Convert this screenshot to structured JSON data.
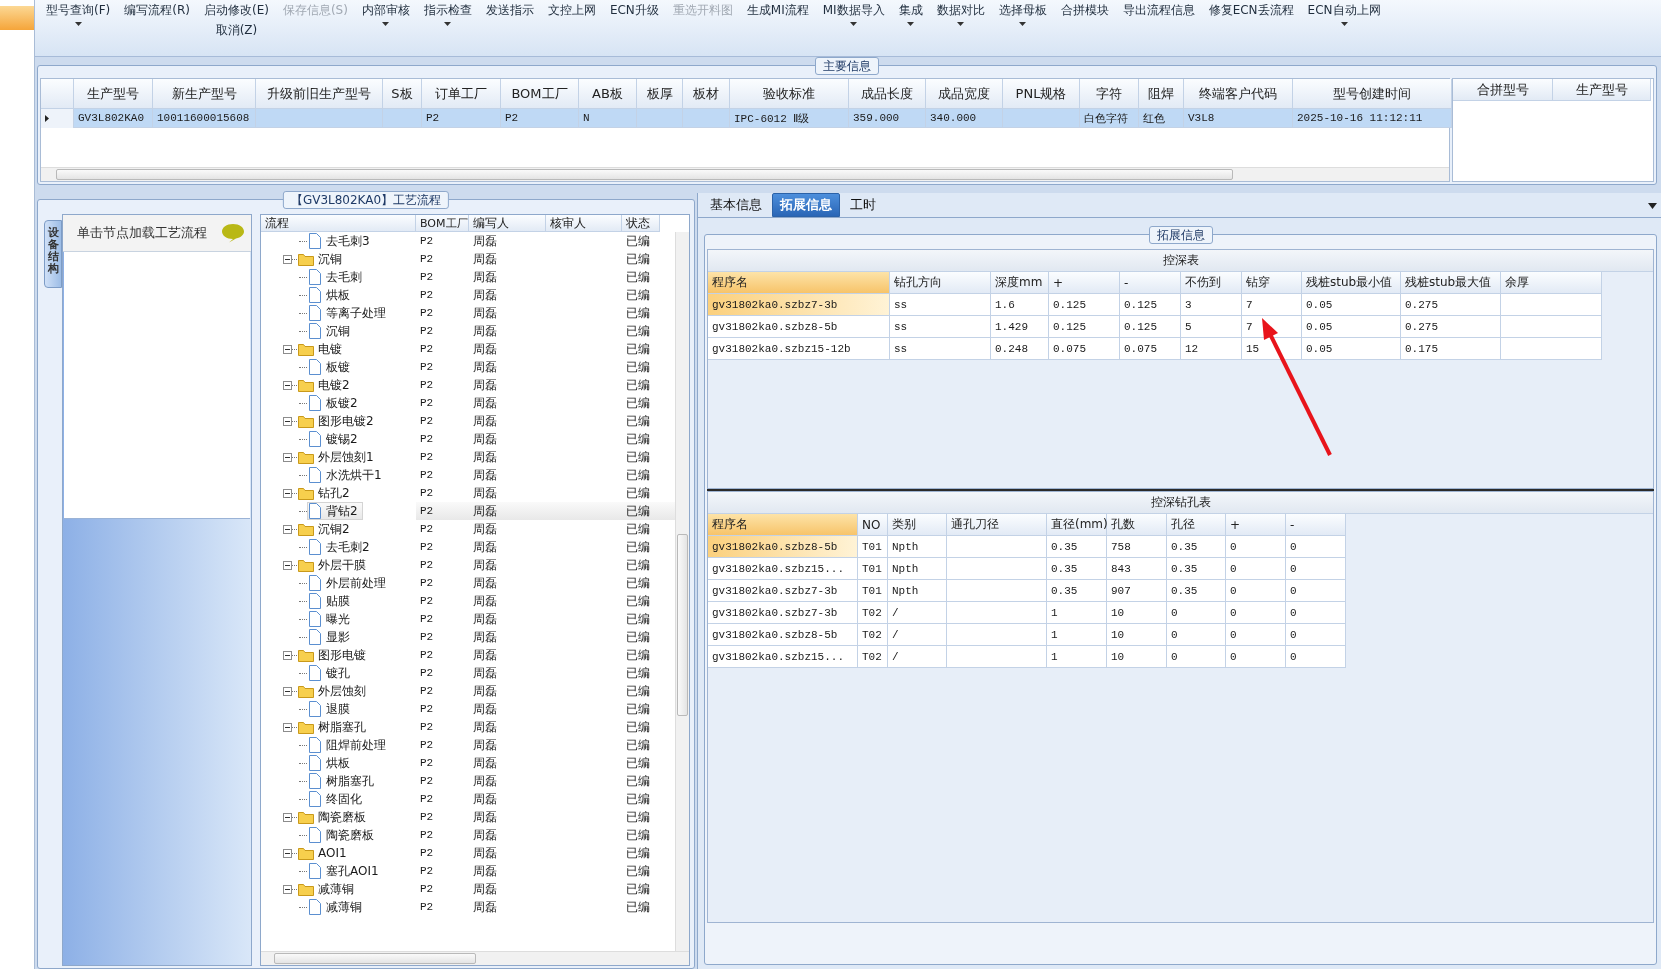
{
  "toolbar": [
    {
      "label": "型号查询(F)",
      "dropdown": true,
      "disabled": false
    },
    {
      "label": "编写流程(R)",
      "dropdown": false,
      "disabled": false
    },
    {
      "label": "启动修改(E)",
      "sublabel": "取消(Z)",
      "dropdown": false,
      "disabled": false
    },
    {
      "label": "保存信息(S)",
      "dropdown": false,
      "disabled": true
    },
    {
      "label": "内部审核",
      "dropdown": true,
      "disabled": false
    },
    {
      "label": "指示检查",
      "dropdown": true,
      "disabled": false
    },
    {
      "label": "发送指示",
      "dropdown": false,
      "disabled": false
    },
    {
      "label": "文控上网",
      "dropdown": false,
      "disabled": false
    },
    {
      "label": "ECN升级",
      "dropdown": false,
      "disabled": false
    },
    {
      "label": "重选开料图",
      "dropdown": false,
      "disabled": true
    },
    {
      "label": "生成MI流程",
      "dropdown": false,
      "disabled": false
    },
    {
      "label": "MI数据导入",
      "dropdown": true,
      "disabled": false
    },
    {
      "label": "集成",
      "dropdown": true,
      "disabled": false
    },
    {
      "label": "数据对比",
      "dropdown": true,
      "disabled": false
    },
    {
      "label": "选择母板",
      "dropdown": true,
      "disabled": false
    },
    {
      "label": "合拼模块",
      "dropdown": false,
      "disabled": false
    },
    {
      "label": "导出流程信息",
      "dropdown": false,
      "disabled": false
    },
    {
      "label": "修复ECN丢流程",
      "dropdown": false,
      "disabled": false
    },
    {
      "label": "ECN自动上网",
      "dropdown": true,
      "disabled": false
    }
  ],
  "main_info": {
    "title": "主要信息",
    "columns": [
      "生产型号",
      "新生产型号",
      "升级前旧生产型号",
      "S板",
      "订单工厂",
      "BOM工厂",
      "AB板",
      "板厚",
      "板材",
      "验收标准",
      "成品长度",
      "成品宽度",
      "PNL规格",
      "字符",
      "阻焊",
      "终端客户代码",
      "型号创建时间"
    ],
    "rows": [
      {
        "selected": true,
        "cells": [
          "GV3L802KA0",
          "10011600015608",
          null,
          null,
          "P2",
          "P2",
          "N",
          null,
          null,
          "IPC-6012 Ⅱ级",
          "359.000",
          "340.000",
          null,
          "白色字符",
          "红色",
          "V3L8",
          "2025-10-16 11:12:11"
        ]
      }
    ],
    "merge_table": {
      "columns": [
        "合拼型号",
        "生产型号"
      ]
    }
  },
  "process_panel": {
    "title": "【GV3L802KA0】工艺流程",
    "side_tab": "设备结构",
    "hint": "单击节点加载工艺流程",
    "columns": [
      "流程",
      "BOM工厂",
      "编写人",
      "核审人",
      "状态"
    ],
    "continued_rows": [
      {
        "label": "去毛刺3",
        "bom": "P2",
        "writer": "周磊",
        "status": "已编",
        "selected": false
      }
    ],
    "rows": [
      {
        "label": "沉铜",
        "bom": "P2",
        "writer": "周磊",
        "status": "已编",
        "selected": false,
        "expanded": true,
        "children": [
          {
            "label": "去毛刺",
            "bom": "P2",
            "writer": "周磊",
            "status": "已编",
            "selected": false
          },
          {
            "label": "烘板",
            "bom": "P2",
            "writer": "周磊",
            "status": "已编",
            "selected": false
          },
          {
            "label": "等离子处理",
            "bom": "P2",
            "writer": "周磊",
            "status": "已编",
            "selected": false
          },
          {
            "label": "沉铜",
            "bom": "P2",
            "writer": "周磊",
            "status": "已编",
            "selected": false
          }
        ]
      },
      {
        "label": "电镀",
        "bom": "P2",
        "writer": "周磊",
        "status": "已编",
        "selected": false,
        "expanded": true,
        "children": [
          {
            "label": "板镀",
            "bom": "P2",
            "writer": "周磊",
            "status": "已编",
            "selected": false
          }
        ]
      },
      {
        "label": "电镀2",
        "bom": "P2",
        "writer": "周磊",
        "status": "已编",
        "selected": false,
        "expanded": true,
        "children": [
          {
            "label": "板镀2",
            "bom": "P2",
            "writer": "周磊",
            "status": "已编",
            "selected": false
          }
        ]
      },
      {
        "label": "图形电镀2",
        "bom": "P2",
        "writer": "周磊",
        "status": "已编",
        "selected": false,
        "expanded": true,
        "children": [
          {
            "label": "镀锡2",
            "bom": "P2",
            "writer": "周磊",
            "status": "已编",
            "selected": false
          }
        ]
      },
      {
        "label": "外层蚀刻1",
        "bom": "P2",
        "writer": "周磊",
        "status": "已编",
        "selected": false,
        "expanded": true,
        "children": [
          {
            "label": "水洗烘干1",
            "bom": "P2",
            "writer": "周磊",
            "status": "已编",
            "selected": false
          }
        ]
      },
      {
        "label": "钻孔2",
        "bom": "P2",
        "writer": "周磊",
        "status": "已编",
        "selected": false,
        "expanded": true,
        "children": [
          {
            "label": "背钻2",
            "bom": "P2",
            "writer": "周磊",
            "status": "已编",
            "selected": true
          }
        ]
      },
      {
        "label": "沉铜2",
        "bom": "P2",
        "writer": "周磊",
        "status": "已编",
        "selected": false,
        "expanded": true,
        "children": [
          {
            "label": "去毛刺2",
            "bom": "P2",
            "writer": "周磊",
            "status": "已编",
            "selected": false
          }
        ]
      },
      {
        "label": "外层干膜",
        "bom": "P2",
        "writer": "周磊",
        "status": "已编",
        "selected": false,
        "expanded": true,
        "children": [
          {
            "label": "外层前处理",
            "bom": "P2",
            "writer": "周磊",
            "status": "已编",
            "selected": false
          },
          {
            "label": "贴膜",
            "bom": "P2",
            "writer": "周磊",
            "status": "已编",
            "selected": false
          },
          {
            "label": "曝光",
            "bom": "P2",
            "writer": "周磊",
            "status": "已编",
            "selected": false
          },
          {
            "label": "显影",
            "bom": "P2",
            "writer": "周磊",
            "status": "已编",
            "selected": false
          }
        ]
      },
      {
        "label": "图形电镀",
        "bom": "P2",
        "writer": "周磊",
        "status": "已编",
        "selected": false,
        "expanded": true,
        "children": [
          {
            "label": "镀孔",
            "bom": "P2",
            "writer": "周磊",
            "status": "已编",
            "selected": false
          }
        ]
      },
      {
        "label": "外层蚀刻",
        "bom": "P2",
        "writer": "周磊",
        "status": "已编",
        "selected": false,
        "expanded": true,
        "children": [
          {
            "label": "退膜",
            "bom": "P2",
            "writer": "周磊",
            "status": "已编",
            "selected": false
          }
        ]
      },
      {
        "label": "树脂塞孔",
        "bom": "P2",
        "writer": "周磊",
        "status": "已编",
        "selected": false,
        "expanded": true,
        "children": [
          {
            "label": "阻焊前处理",
            "bom": "P2",
            "writer": "周磊",
            "status": "已编",
            "selected": false
          },
          {
            "label": "烘板",
            "bom": "P2",
            "writer": "周磊",
            "status": "已编",
            "selected": false
          },
          {
            "label": "树脂塞孔",
            "bom": "P2",
            "writer": "周磊",
            "status": "已编",
            "selected": false
          },
          {
            "label": "终固化",
            "bom": "P2",
            "writer": "周磊",
            "status": "已编",
            "selected": false
          }
        ]
      },
      {
        "label": "陶瓷磨板",
        "bom": "P2",
        "writer": "周磊",
        "status": "已编",
        "selected": false,
        "expanded": true,
        "children": [
          {
            "label": "陶瓷磨板",
            "bom": "P2",
            "writer": "周磊",
            "status": "已编",
            "selected": false
          }
        ]
      },
      {
        "label": "AOI1",
        "bom": "P2",
        "writer": "周磊",
        "status": "已编",
        "selected": false,
        "expanded": true,
        "children": [
          {
            "label": "塞孔AOI1",
            "bom": "P2",
            "writer": "周磊",
            "status": "已编",
            "selected": false
          }
        ]
      },
      {
        "label": "减薄铜",
        "bom": "P2",
        "writer": "周磊",
        "status": "已编",
        "selected": false,
        "expanded": true,
        "children": [
          {
            "label": "减薄铜",
            "bom": "P2",
            "writer": "周磊",
            "status": "已编",
            "selected": false
          }
        ]
      }
    ]
  },
  "detail_panel": {
    "tabs": [
      {
        "label": "基本信息",
        "selected": false
      },
      {
        "label": "拓展信息",
        "selected": true
      },
      {
        "label": "工时",
        "selected": false
      }
    ],
    "group_title": "拓展信息",
    "depth_table": {
      "title": "控深表",
      "columns": [
        "程序名",
        "钻孔方向",
        "深度mm",
        "+",
        "-",
        "不伤到",
        "钻穿",
        "残桩stub最小值",
        "残桩stub最大值",
        "余厚"
      ],
      "rows": [
        {
          "selected": true,
          "cells": [
            "gv31802ka0.szbz7-3b",
            "ss",
            "1.6",
            "0.125",
            "0.125",
            "3",
            "7",
            "0.05",
            "0.275",
            null
          ]
        },
        {
          "selected": false,
          "cells": [
            "gv31802ka0.szbz8-5b",
            "ss",
            "1.429",
            "0.125",
            "0.125",
            "5",
            "7",
            "0.05",
            "0.275",
            null
          ]
        },
        {
          "selected": false,
          "cells": [
            "gv31802ka0.szbz15-12b",
            "ss",
            "0.248",
            "0.075",
            "0.075",
            "12",
            "15",
            "0.05",
            "0.175",
            null
          ]
        }
      ]
    },
    "drill_table": {
      "title": "控深钻孔表",
      "columns": [
        "程序名",
        "NO",
        "类别",
        "通孔刀径",
        "直径(mm)",
        "孔数",
        "孔径",
        "+",
        "-"
      ],
      "rows": [
        {
          "selected": true,
          "cells": [
            "gv31802ka0.szbz8-5b",
            "T01",
            "Npth",
            null,
            "0.35",
            "758",
            "0.35",
            "0",
            "0"
          ]
        },
        {
          "selected": false,
          "cells": [
            "gv31802ka0.szbz15...",
            "T01",
            "Npth",
            null,
            "0.35",
            "843",
            "0.35",
            "0",
            "0"
          ]
        },
        {
          "selected": false,
          "cells": [
            "gv31802ka0.szbz7-3b",
            "T01",
            "Npth",
            null,
            "0.35",
            "907",
            "0.35",
            "0",
            "0"
          ]
        },
        {
          "selected": false,
          "cells": [
            "gv31802ka0.szbz7-3b",
            "T02",
            "/",
            null,
            "1",
            "10",
            "0",
            "0",
            "0"
          ]
        },
        {
          "selected": false,
          "cells": [
            "gv31802ka0.szbz8-5b",
            "T02",
            "/",
            null,
            "1",
            "10",
            "0",
            "0",
            "0"
          ]
        },
        {
          "selected": false,
          "cells": [
            "gv31802ka0.szbz15...",
            "T02",
            "/",
            null,
            "1",
            "10",
            "0",
            "0",
            "0"
          ]
        }
      ]
    }
  }
}
